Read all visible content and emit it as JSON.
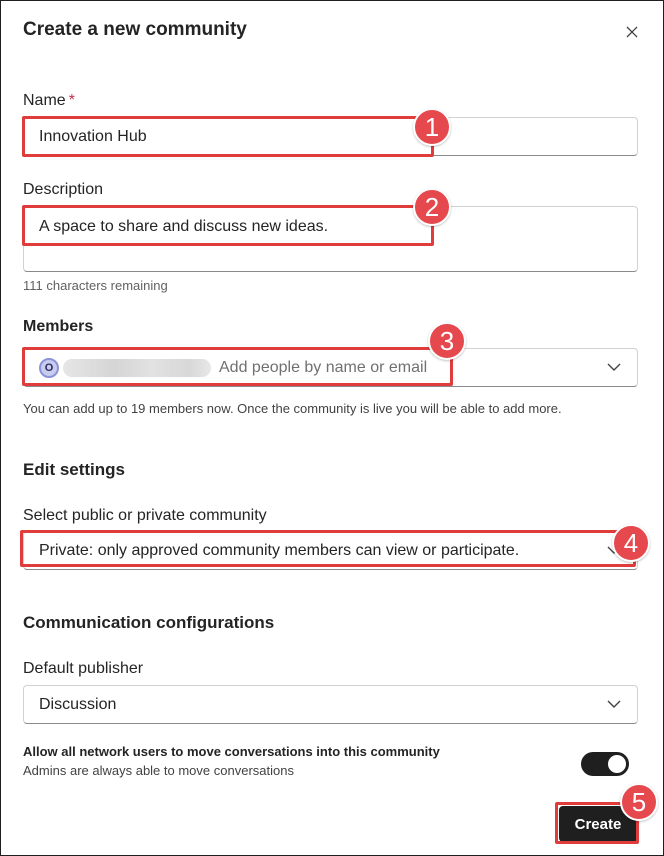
{
  "dialog": {
    "title": "Create a new community",
    "close_icon": "close-icon"
  },
  "name_field": {
    "label": "Name",
    "required_mark": "*",
    "value": "Innovation Hub"
  },
  "description_field": {
    "label": "Description",
    "value": "A space to share and discuss new ideas.",
    "chars_remaining": "111 characters remaining"
  },
  "members_field": {
    "label": "Members",
    "chip_initial": "O",
    "placeholder": "Add people by name or email",
    "hint": "You can add up to 19 members now. Once the community is live you will be able to add more."
  },
  "edit_settings": {
    "title": "Edit settings",
    "privacy_label": "Select public or private community",
    "privacy_value": "Private: only approved community members can view or participate."
  },
  "communication": {
    "title": "Communication configurations",
    "publisher_label": "Default publisher",
    "publisher_value": "Discussion",
    "toggle_title": "Allow all network users to move conversations into this community",
    "toggle_subtitle": "Admins are always able to move conversations",
    "toggle_on": true
  },
  "footer": {
    "create_label": "Create"
  },
  "annotations": [
    {
      "number": "1"
    },
    {
      "number": "2"
    },
    {
      "number": "3"
    },
    {
      "number": "4"
    },
    {
      "number": "5"
    }
  ],
  "colors": {
    "annotation_red": "#e5484d",
    "button_dark": "#1f1f1f",
    "required_red": "#c4314b"
  }
}
